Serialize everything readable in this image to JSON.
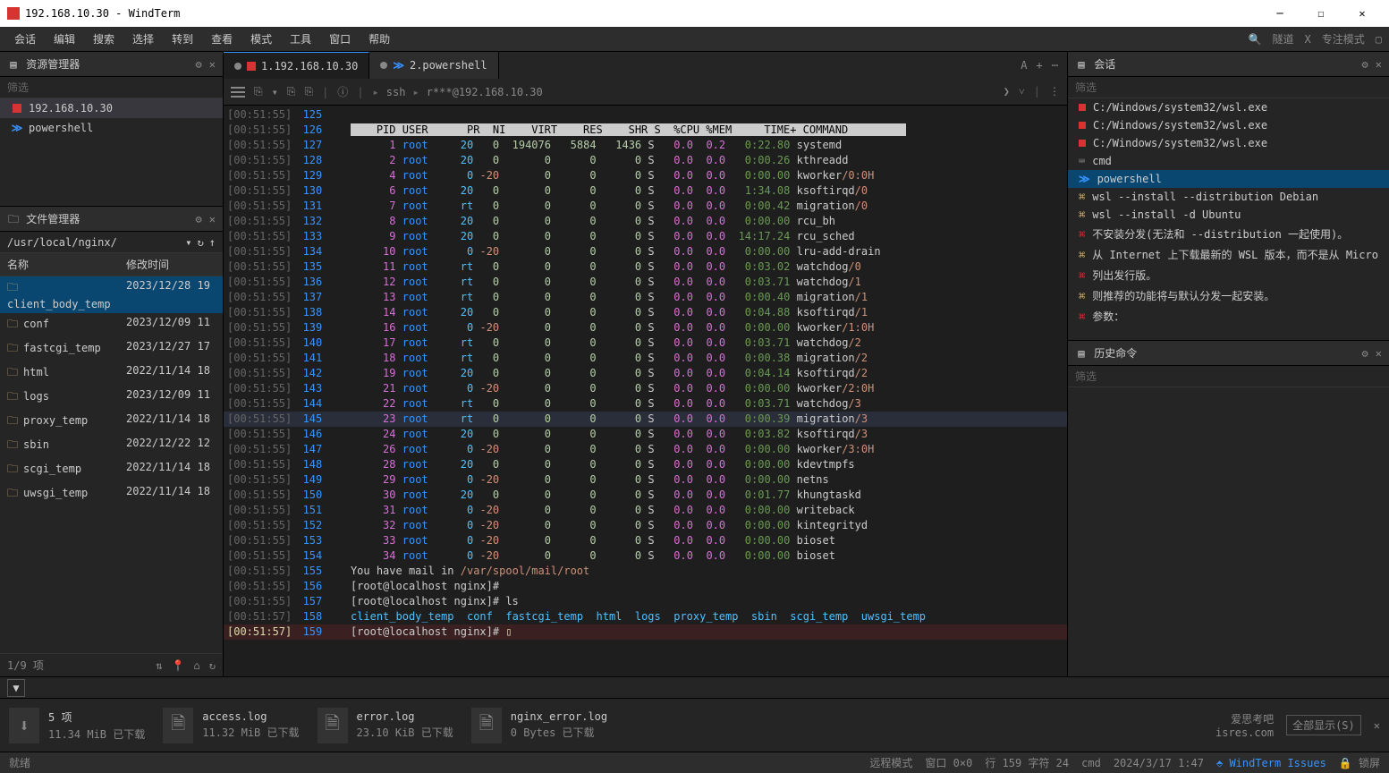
{
  "window": {
    "title": "192.168.10.30 - WindTerm"
  },
  "menu": [
    "会话",
    "编辑",
    "搜索",
    "选择",
    "转到",
    "查看",
    "模式",
    "工具",
    "窗口",
    "帮助"
  ],
  "menuRight": {
    "tunnel": "隧道",
    "x": "X",
    "focus": "专注模式"
  },
  "resMgr": {
    "title": "资源管理器",
    "filter": "筛选",
    "items": [
      {
        "icon": "red",
        "label": "192.168.10.30"
      },
      {
        "icon": "blue",
        "label": "powershell"
      }
    ]
  },
  "fileMgr": {
    "title": "文件管理器",
    "path": "/usr/local/nginx/",
    "cols": {
      "name": "名称",
      "time": "修改时间"
    },
    "files": [
      {
        "name": "client_body_temp",
        "time": "2023/12/28 19"
      },
      {
        "name": "conf",
        "time": "2023/12/09 11"
      },
      {
        "name": "fastcgi_temp",
        "time": "2023/12/27 17"
      },
      {
        "name": "html",
        "time": "2022/11/14 18"
      },
      {
        "name": "logs",
        "time": "2023/12/09 11"
      },
      {
        "name": "proxy_temp",
        "time": "2022/11/14 18"
      },
      {
        "name": "sbin",
        "time": "2022/12/22 12"
      },
      {
        "name": "scgi_temp",
        "time": "2022/11/14 18"
      },
      {
        "name": "uwsgi_temp",
        "time": "2022/11/14 18"
      }
    ],
    "stat": "1/9 项"
  },
  "tabs": [
    {
      "label": "1.192.168.10.30",
      "active": true,
      "icon": "red"
    },
    {
      "label": "2.powershell",
      "active": false,
      "icon": "blue"
    }
  ],
  "breadcrumb": {
    "ssh": "ssh",
    "host": "r***@192.168.10.30"
  },
  "top_header": "    PID USER      PR  NI    VIRT    RES    SHR S  %CPU %MEM     TIME+ COMMAND",
  "processes": [
    {
      "ts": "[00:51:55]",
      "ln": "125"
    },
    {
      "ts": "[00:51:55]",
      "ln": "126",
      "header": true
    },
    {
      "ts": "[00:51:55]",
      "ln": "127",
      "pid": "1",
      "user": "root",
      "pr": "20",
      "ni": "0",
      "virt": "194076",
      "res": "5884",
      "shr": "1436",
      "s": "S",
      "cpu": "0.0",
      "mem": "0.2",
      "time": "0:22.80",
      "cmd": "systemd"
    },
    {
      "ts": "[00:51:55]",
      "ln": "128",
      "pid": "2",
      "user": "root",
      "pr": "20",
      "ni": "0",
      "virt": "0",
      "res": "0",
      "shr": "0",
      "s": "S",
      "cpu": "0.0",
      "mem": "0.0",
      "time": "0:00.26",
      "cmd": "kthreadd"
    },
    {
      "ts": "[00:51:55]",
      "ln": "129",
      "pid": "4",
      "user": "root",
      "pr": "0",
      "ni": "-20",
      "virt": "0",
      "res": "0",
      "shr": "0",
      "s": "S",
      "cpu": "0.0",
      "mem": "0.0",
      "time": "0:00.00",
      "cmd": "kworker",
      "suf": "/0:0H"
    },
    {
      "ts": "[00:51:55]",
      "ln": "130",
      "pid": "6",
      "user": "root",
      "pr": "20",
      "ni": "0",
      "virt": "0",
      "res": "0",
      "shr": "0",
      "s": "S",
      "cpu": "0.0",
      "mem": "0.0",
      "time": "1:34.08",
      "cmd": "ksoftirqd",
      "suf": "/0"
    },
    {
      "ts": "[00:51:55]",
      "ln": "131",
      "pid": "7",
      "user": "root",
      "pr": "rt",
      "ni": "0",
      "virt": "0",
      "res": "0",
      "shr": "0",
      "s": "S",
      "cpu": "0.0",
      "mem": "0.0",
      "time": "0:00.42",
      "cmd": "migration",
      "suf": "/0"
    },
    {
      "ts": "[00:51:55]",
      "ln": "132",
      "pid": "8",
      "user": "root",
      "pr": "20",
      "ni": "0",
      "virt": "0",
      "res": "0",
      "shr": "0",
      "s": "S",
      "cpu": "0.0",
      "mem": "0.0",
      "time": "0:00.00",
      "cmd": "rcu_bh"
    },
    {
      "ts": "[00:51:55]",
      "ln": "133",
      "pid": "9",
      "user": "root",
      "pr": "20",
      "ni": "0",
      "virt": "0",
      "res": "0",
      "shr": "0",
      "s": "S",
      "cpu": "0.0",
      "mem": "0.0",
      "time": "14:17.24",
      "cmd": "rcu_sched"
    },
    {
      "ts": "[00:51:55]",
      "ln": "134",
      "pid": "10",
      "user": "root",
      "pr": "0",
      "ni": "-20",
      "virt": "0",
      "res": "0",
      "shr": "0",
      "s": "S",
      "cpu": "0.0",
      "mem": "0.0",
      "time": "0:00.00",
      "cmd": "lru-add-drain"
    },
    {
      "ts": "[00:51:55]",
      "ln": "135",
      "pid": "11",
      "user": "root",
      "pr": "rt",
      "ni": "0",
      "virt": "0",
      "res": "0",
      "shr": "0",
      "s": "S",
      "cpu": "0.0",
      "mem": "0.0",
      "time": "0:03.02",
      "cmd": "watchdog",
      "suf": "/0"
    },
    {
      "ts": "[00:51:55]",
      "ln": "136",
      "pid": "12",
      "user": "root",
      "pr": "rt",
      "ni": "0",
      "virt": "0",
      "res": "0",
      "shr": "0",
      "s": "S",
      "cpu": "0.0",
      "mem": "0.0",
      "time": "0:03.71",
      "cmd": "watchdog",
      "suf": "/1"
    },
    {
      "ts": "[00:51:55]",
      "ln": "137",
      "pid": "13",
      "user": "root",
      "pr": "rt",
      "ni": "0",
      "virt": "0",
      "res": "0",
      "shr": "0",
      "s": "S",
      "cpu": "0.0",
      "mem": "0.0",
      "time": "0:00.40",
      "cmd": "migration",
      "suf": "/1"
    },
    {
      "ts": "[00:51:55]",
      "ln": "138",
      "pid": "14",
      "user": "root",
      "pr": "20",
      "ni": "0",
      "virt": "0",
      "res": "0",
      "shr": "0",
      "s": "S",
      "cpu": "0.0",
      "mem": "0.0",
      "time": "0:04.88",
      "cmd": "ksoftirqd",
      "suf": "/1"
    },
    {
      "ts": "[00:51:55]",
      "ln": "139",
      "pid": "16",
      "user": "root",
      "pr": "0",
      "ni": "-20",
      "virt": "0",
      "res": "0",
      "shr": "0",
      "s": "S",
      "cpu": "0.0",
      "mem": "0.0",
      "time": "0:00.00",
      "cmd": "kworker",
      "suf": "/1:0H"
    },
    {
      "ts": "[00:51:55]",
      "ln": "140",
      "pid": "17",
      "user": "root",
      "pr": "rt",
      "ni": "0",
      "virt": "0",
      "res": "0",
      "shr": "0",
      "s": "S",
      "cpu": "0.0",
      "mem": "0.0",
      "time": "0:03.71",
      "cmd": "watchdog",
      "suf": "/2"
    },
    {
      "ts": "[00:51:55]",
      "ln": "141",
      "pid": "18",
      "user": "root",
      "pr": "rt",
      "ni": "0",
      "virt": "0",
      "res": "0",
      "shr": "0",
      "s": "S",
      "cpu": "0.0",
      "mem": "0.0",
      "time": "0:00.38",
      "cmd": "migration",
      "suf": "/2"
    },
    {
      "ts": "[00:51:55]",
      "ln": "142",
      "pid": "19",
      "user": "root",
      "pr": "20",
      "ni": "0",
      "virt": "0",
      "res": "0",
      "shr": "0",
      "s": "S",
      "cpu": "0.0",
      "mem": "0.0",
      "time": "0:04.14",
      "cmd": "ksoftirqd",
      "suf": "/2"
    },
    {
      "ts": "[00:51:55]",
      "ln": "143",
      "pid": "21",
      "user": "root",
      "pr": "0",
      "ni": "-20",
      "virt": "0",
      "res": "0",
      "shr": "0",
      "s": "S",
      "cpu": "0.0",
      "mem": "0.0",
      "time": "0:00.00",
      "cmd": "kworker",
      "suf": "/2:0H"
    },
    {
      "ts": "[00:51:55]",
      "ln": "144",
      "pid": "22",
      "user": "root",
      "pr": "rt",
      "ni": "0",
      "virt": "0",
      "res": "0",
      "shr": "0",
      "s": "S",
      "cpu": "0.0",
      "mem": "0.0",
      "time": "0:03.71",
      "cmd": "watchdog",
      "suf": "/3"
    },
    {
      "ts": "[00:51:55]",
      "ln": "145",
      "pid": "23",
      "user": "root",
      "pr": "rt",
      "ni": "0",
      "virt": "0",
      "res": "0",
      "shr": "0",
      "s": "S",
      "cpu": "0.0",
      "mem": "0.0",
      "time": "0:00.39",
      "cmd": "migration",
      "suf": "/3",
      "hl": true
    },
    {
      "ts": "[00:51:55]",
      "ln": "146",
      "pid": "24",
      "user": "root",
      "pr": "20",
      "ni": "0",
      "virt": "0",
      "res": "0",
      "shr": "0",
      "s": "S",
      "cpu": "0.0",
      "mem": "0.0",
      "time": "0:03.82",
      "cmd": "ksoftirqd",
      "suf": "/3"
    },
    {
      "ts": "[00:51:55]",
      "ln": "147",
      "pid": "26",
      "user": "root",
      "pr": "0",
      "ni": "-20",
      "virt": "0",
      "res": "0",
      "shr": "0",
      "s": "S",
      "cpu": "0.0",
      "mem": "0.0",
      "time": "0:00.00",
      "cmd": "kworker",
      "suf": "/3:0H"
    },
    {
      "ts": "[00:51:55]",
      "ln": "148",
      "pid": "28",
      "user": "root",
      "pr": "20",
      "ni": "0",
      "virt": "0",
      "res": "0",
      "shr": "0",
      "s": "S",
      "cpu": "0.0",
      "mem": "0.0",
      "time": "0:00.00",
      "cmd": "kdevtmpfs"
    },
    {
      "ts": "[00:51:55]",
      "ln": "149",
      "pid": "29",
      "user": "root",
      "pr": "0",
      "ni": "-20",
      "virt": "0",
      "res": "0",
      "shr": "0",
      "s": "S",
      "cpu": "0.0",
      "mem": "0.0",
      "time": "0:00.00",
      "cmd": "netns"
    },
    {
      "ts": "[00:51:55]",
      "ln": "150",
      "pid": "30",
      "user": "root",
      "pr": "20",
      "ni": "0",
      "virt": "0",
      "res": "0",
      "shr": "0",
      "s": "S",
      "cpu": "0.0",
      "mem": "0.0",
      "time": "0:01.77",
      "cmd": "khungtaskd"
    },
    {
      "ts": "[00:51:55]",
      "ln": "151",
      "pid": "31",
      "user": "root",
      "pr": "0",
      "ni": "-20",
      "virt": "0",
      "res": "0",
      "shr": "0",
      "s": "S",
      "cpu": "0.0",
      "mem": "0.0",
      "time": "0:00.00",
      "cmd": "writeback"
    },
    {
      "ts": "[00:51:55]",
      "ln": "152",
      "pid": "32",
      "user": "root",
      "pr": "0",
      "ni": "-20",
      "virt": "0",
      "res": "0",
      "shr": "0",
      "s": "S",
      "cpu": "0.0",
      "mem": "0.0",
      "time": "0:00.00",
      "cmd": "kintegrityd"
    },
    {
      "ts": "[00:51:55]",
      "ln": "153",
      "pid": "33",
      "user": "root",
      "pr": "0",
      "ni": "-20",
      "virt": "0",
      "res": "0",
      "shr": "0",
      "s": "S",
      "cpu": "0.0",
      "mem": "0.0",
      "time": "0:00.00",
      "cmd": "bioset"
    },
    {
      "ts": "[00:51:55]",
      "ln": "154",
      "pid": "34",
      "user": "root",
      "pr": "0",
      "ni": "-20",
      "virt": "0",
      "res": "0",
      "shr": "0",
      "s": "S",
      "cpu": "0.0",
      "mem": "0.0",
      "time": "0:00.00",
      "cmd": "bioset"
    }
  ],
  "promptLines": [
    {
      "ts": "[00:51:55]",
      "ln": "155",
      "text": "You have mail in ",
      "path": "/var/spool/mail/root"
    },
    {
      "ts": "[00:51:55]",
      "ln": "156",
      "prompt": "[root@localhost nginx]#"
    },
    {
      "ts": "[00:51:55]",
      "ln": "157",
      "prompt": "[root@localhost nginx]# ",
      "cmd": "ls"
    },
    {
      "ts": "[00:51:57]",
      "ln": "158",
      "dirs": [
        "client_body_temp",
        "conf",
        "fastcgi_temp",
        "html",
        "logs",
        "proxy_temp",
        "sbin",
        "scgi_temp",
        "uwsgi_temp"
      ]
    },
    {
      "ts": "[00:51:57]",
      "ln": "159",
      "prompt": "[root@localhost nginx]# ",
      "cursor": true,
      "cur": true
    }
  ],
  "sessions": {
    "title": "会话",
    "filter": "筛选",
    "items": [
      {
        "icon": "red",
        "label": "C:/Windows/system32/wsl.exe"
      },
      {
        "icon": "red",
        "label": "C:/Windows/system32/wsl.exe"
      },
      {
        "icon": "red",
        "label": "C:/Windows/system32/wsl.exe"
      },
      {
        "icon": "cmd",
        "label": "cmd"
      },
      {
        "icon": "blue",
        "label": "powershell",
        "sel": true
      },
      {
        "icon": "key",
        "label": "wsl --install --distribution Debian"
      },
      {
        "icon": "key",
        "label": "wsl --install -d Ubuntu"
      },
      {
        "icon": "key",
        "label": "不安装分发(无法和 --distribution 一起使用)。",
        "red": true
      },
      {
        "icon": "key",
        "label": "从 Internet 上下载最新的 WSL 版本，而不是从 Micro"
      },
      {
        "icon": "key",
        "label": "列出发行版。",
        "red": true
      },
      {
        "icon": "key",
        "label": "则推荐的功能将与默认分发一起安装。"
      },
      {
        "icon": "key",
        "label": "参数：",
        "red": true
      }
    ]
  },
  "history": {
    "title": "历史命令",
    "filter": "筛选"
  },
  "downloads": {
    "summary": {
      "count": "5 项",
      "size": "11.34 MiB 已下载"
    },
    "items": [
      {
        "name": "access.log",
        "info": "11.32 MiB 已下载"
      },
      {
        "name": "error.log",
        "info": "23.10 KiB 已下载"
      },
      {
        "name": "nginx_error.log",
        "info": "0 Bytes 已下载"
      }
    ],
    "site": "爱思考吧",
    "url": "isres.com",
    "showAll": "全部显示(S)"
  },
  "status": {
    "ready": "就绪",
    "mode": "远程模式",
    "win": "窗口 0×0",
    "pos": "行 159 字符 24",
    "enc": "cmd",
    "time": "2024/3/17 1:47",
    "issues": "WindTerm Issues",
    "lock": "锁屏"
  }
}
